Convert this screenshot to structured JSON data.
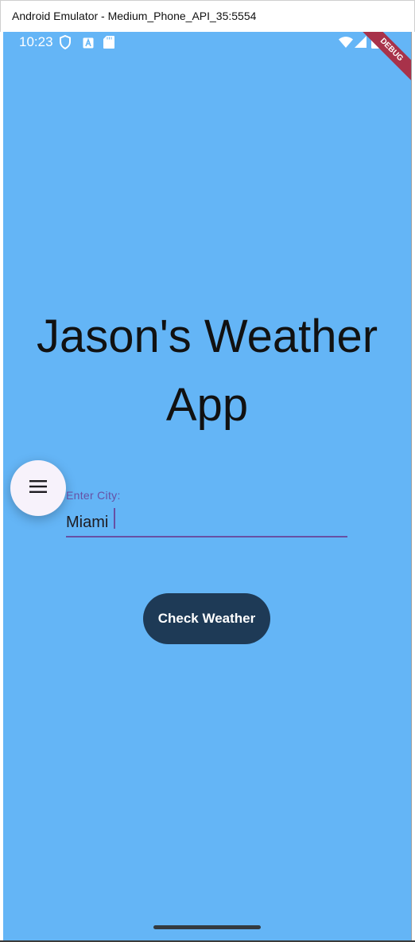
{
  "window": {
    "title": "Android Emulator - Medium_Phone_API_35:5554"
  },
  "status_bar": {
    "time": "10:23",
    "debug_banner": "DEBUG",
    "icons": [
      "shield-icon",
      "a-icon",
      "sd-card-icon",
      "wifi-icon",
      "cell-signal-icon",
      "battery-icon"
    ]
  },
  "app": {
    "title": "Jason's Weather App",
    "city_field": {
      "label": "Enter City:",
      "value": "Miami"
    },
    "check_button_label": "Check Weather",
    "menu_icon": "menu-icon"
  },
  "colors": {
    "screen_background": "#64b5f6",
    "accent": "#6750a4",
    "button_background": "#1e3a56",
    "fab_background": "#f7f2fb",
    "debug_banner": "#a8324a"
  }
}
